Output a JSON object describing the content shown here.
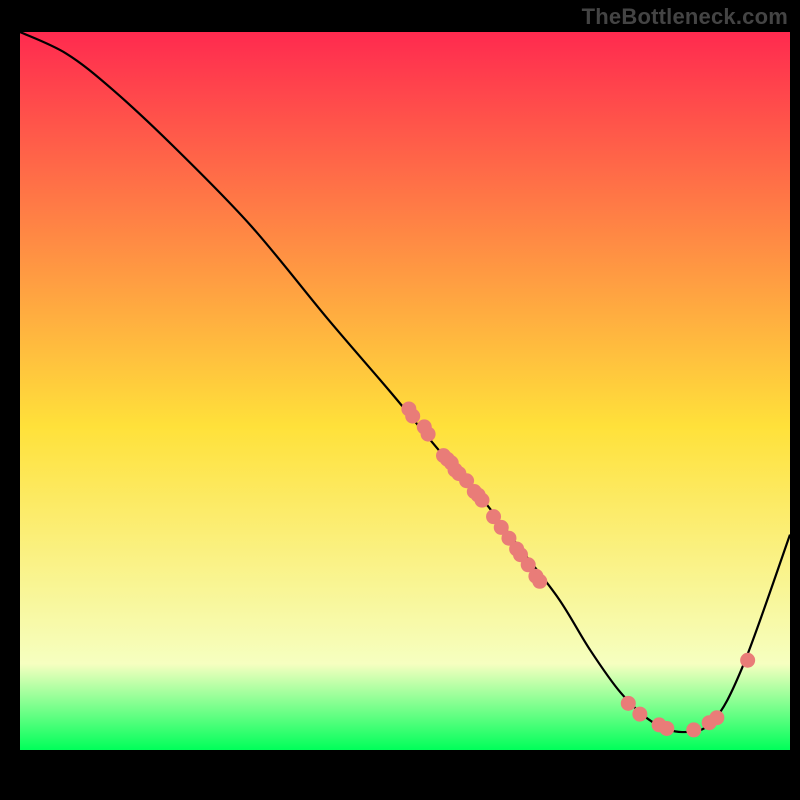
{
  "brand": "TheBottleneck.com",
  "colors": {
    "gradient_top": "#ff2a4f",
    "gradient_mid": "#ffe13a",
    "gradient_low": "#f6ffc0",
    "gradient_bottom": "#00ff5a",
    "curve": "#000000",
    "marker": "#e97c78",
    "frame": "#000000"
  },
  "chart_data": {
    "type": "line",
    "title": "",
    "xlabel": "",
    "ylabel": "",
    "xlim": [
      0,
      100
    ],
    "ylim": [
      0,
      100
    ],
    "grid": false,
    "legend": false,
    "series": [
      {
        "name": "bottleneck-curve",
        "x": [
          0,
          6,
          12,
          20,
          30,
          40,
          48,
          55,
          60,
          65,
          70,
          74,
          78,
          82,
          86,
          90,
          94,
          100
        ],
        "y": [
          100,
          97,
          92,
          84,
          73,
          60,
          50,
          41,
          35,
          28,
          21,
          14,
          8,
          4,
          2.5,
          4,
          12,
          30
        ]
      }
    ],
    "markers": {
      "name": "data-points",
      "points": [
        {
          "x": 50.5,
          "y": 47.5
        },
        {
          "x": 51.0,
          "y": 46.5
        },
        {
          "x": 52.5,
          "y": 45.0
        },
        {
          "x": 53.0,
          "y": 44.0
        },
        {
          "x": 55.0,
          "y": 41.0
        },
        {
          "x": 55.5,
          "y": 40.5
        },
        {
          "x": 56.0,
          "y": 40.0
        },
        {
          "x": 56.5,
          "y": 39.0
        },
        {
          "x": 57.0,
          "y": 38.5
        },
        {
          "x": 58.0,
          "y": 37.5
        },
        {
          "x": 59.0,
          "y": 36.0
        },
        {
          "x": 59.5,
          "y": 35.5
        },
        {
          "x": 60.0,
          "y": 34.8
        },
        {
          "x": 61.5,
          "y": 32.5
        },
        {
          "x": 62.5,
          "y": 31.0
        },
        {
          "x": 63.5,
          "y": 29.5
        },
        {
          "x": 64.5,
          "y": 28.0
        },
        {
          "x": 65.0,
          "y": 27.2
        },
        {
          "x": 66.0,
          "y": 25.8
        },
        {
          "x": 67.0,
          "y": 24.2
        },
        {
          "x": 67.5,
          "y": 23.5
        },
        {
          "x": 79.0,
          "y": 6.5
        },
        {
          "x": 80.5,
          "y": 5.0
        },
        {
          "x": 83.0,
          "y": 3.5
        },
        {
          "x": 84.0,
          "y": 3.0
        },
        {
          "x": 87.5,
          "y": 2.8
        },
        {
          "x": 89.5,
          "y": 3.8
        },
        {
          "x": 90.5,
          "y": 4.5
        },
        {
          "x": 94.5,
          "y": 12.5
        }
      ]
    }
  }
}
